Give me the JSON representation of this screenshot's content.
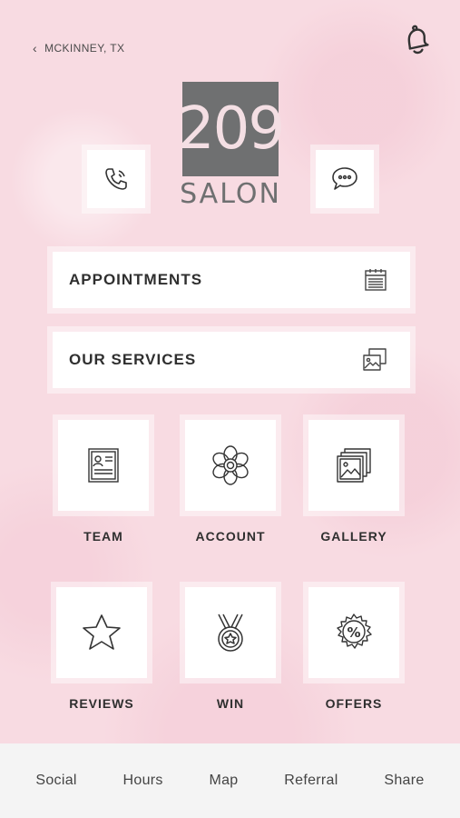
{
  "header": {
    "location": "MCKINNEY, TX"
  },
  "logo": {
    "number": "209",
    "word": "SALON"
  },
  "actions": {
    "call_icon": "phone-icon",
    "chat_icon": "chat-bubble-icon"
  },
  "menu": {
    "appointments": "APPOINTMENTS",
    "services": "OUR SERVICES"
  },
  "tiles": [
    {
      "label": "TEAM",
      "icon": "id-card-icon"
    },
    {
      "label": "ACCOUNT",
      "icon": "flower-icon"
    },
    {
      "label": "GALLERY",
      "icon": "photos-icon"
    },
    {
      "label": "REVIEWS",
      "icon": "star-icon"
    },
    {
      "label": "WIN",
      "icon": "medal-icon"
    },
    {
      "label": "OFFERS",
      "icon": "percent-badge-icon"
    }
  ],
  "tabbar": [
    "Social",
    "Hours",
    "Map",
    "Referral",
    "Share"
  ],
  "colors": {
    "background": "#f8dbe2",
    "logo_gray": "#6f7071",
    "text": "#2f2f2f"
  }
}
